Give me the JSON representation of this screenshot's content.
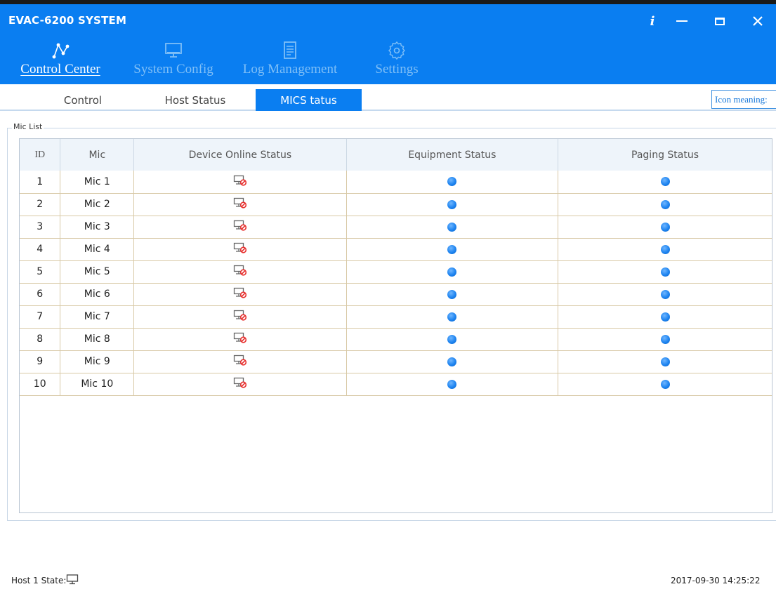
{
  "window": {
    "title": "EVAC-6200 SYSTEM",
    "info_label": "i"
  },
  "nav": {
    "tabs": [
      {
        "label": "Control Center",
        "icon": "network-icon",
        "active": true
      },
      {
        "label": "System Config",
        "icon": "monitor-icon",
        "active": false
      },
      {
        "label": "Log Management",
        "icon": "document-icon",
        "active": false
      },
      {
        "label": "Settings",
        "icon": "gear-icon",
        "active": false
      }
    ]
  },
  "subtabs": {
    "items": [
      {
        "label": "Control",
        "active": false
      },
      {
        "label": "Host Status",
        "active": false
      },
      {
        "label": "MICS tatus",
        "active": true
      }
    ],
    "icon_meaning": "Icon meaning:"
  },
  "mic_list": {
    "title": "Mic List",
    "columns": [
      "ID",
      "Mic",
      "Device Online Status",
      "Equipment Status",
      "Paging Status"
    ],
    "rows": [
      {
        "id": "1",
        "mic": "Mic 1",
        "online": "offline-icon",
        "equipment": "blue-dot",
        "paging": "blue-dot"
      },
      {
        "id": "2",
        "mic": "Mic 2",
        "online": "offline-icon",
        "equipment": "blue-dot",
        "paging": "blue-dot"
      },
      {
        "id": "3",
        "mic": "Mic 3",
        "online": "offline-icon",
        "equipment": "blue-dot",
        "paging": "blue-dot"
      },
      {
        "id": "4",
        "mic": "Mic 4",
        "online": "offline-icon",
        "equipment": "blue-dot",
        "paging": "blue-dot"
      },
      {
        "id": "5",
        "mic": "Mic 5",
        "online": "offline-icon",
        "equipment": "blue-dot",
        "paging": "blue-dot"
      },
      {
        "id": "6",
        "mic": "Mic 6",
        "online": "offline-icon",
        "equipment": "blue-dot",
        "paging": "blue-dot"
      },
      {
        "id": "7",
        "mic": "Mic 7",
        "online": "offline-icon",
        "equipment": "blue-dot",
        "paging": "blue-dot"
      },
      {
        "id": "8",
        "mic": "Mic 8",
        "online": "offline-icon",
        "equipment": "blue-dot",
        "paging": "blue-dot"
      },
      {
        "id": "9",
        "mic": "Mic 9",
        "online": "offline-icon",
        "equipment": "blue-dot",
        "paging": "blue-dot"
      },
      {
        "id": "10",
        "mic": "Mic 10",
        "online": "offline-icon",
        "equipment": "blue-dot",
        "paging": "blue-dot"
      }
    ]
  },
  "statusbar": {
    "host_state_label": "Host 1 State:",
    "host_state_icon": "monitor-icon",
    "timestamp": "2017-09-30 14:25:22"
  },
  "colors": {
    "titlebar": "#0a7ef1",
    "nav_inactive_text": "#7fbff7",
    "status_dot": "#1e84f0",
    "offline_red": "#e8312f"
  }
}
